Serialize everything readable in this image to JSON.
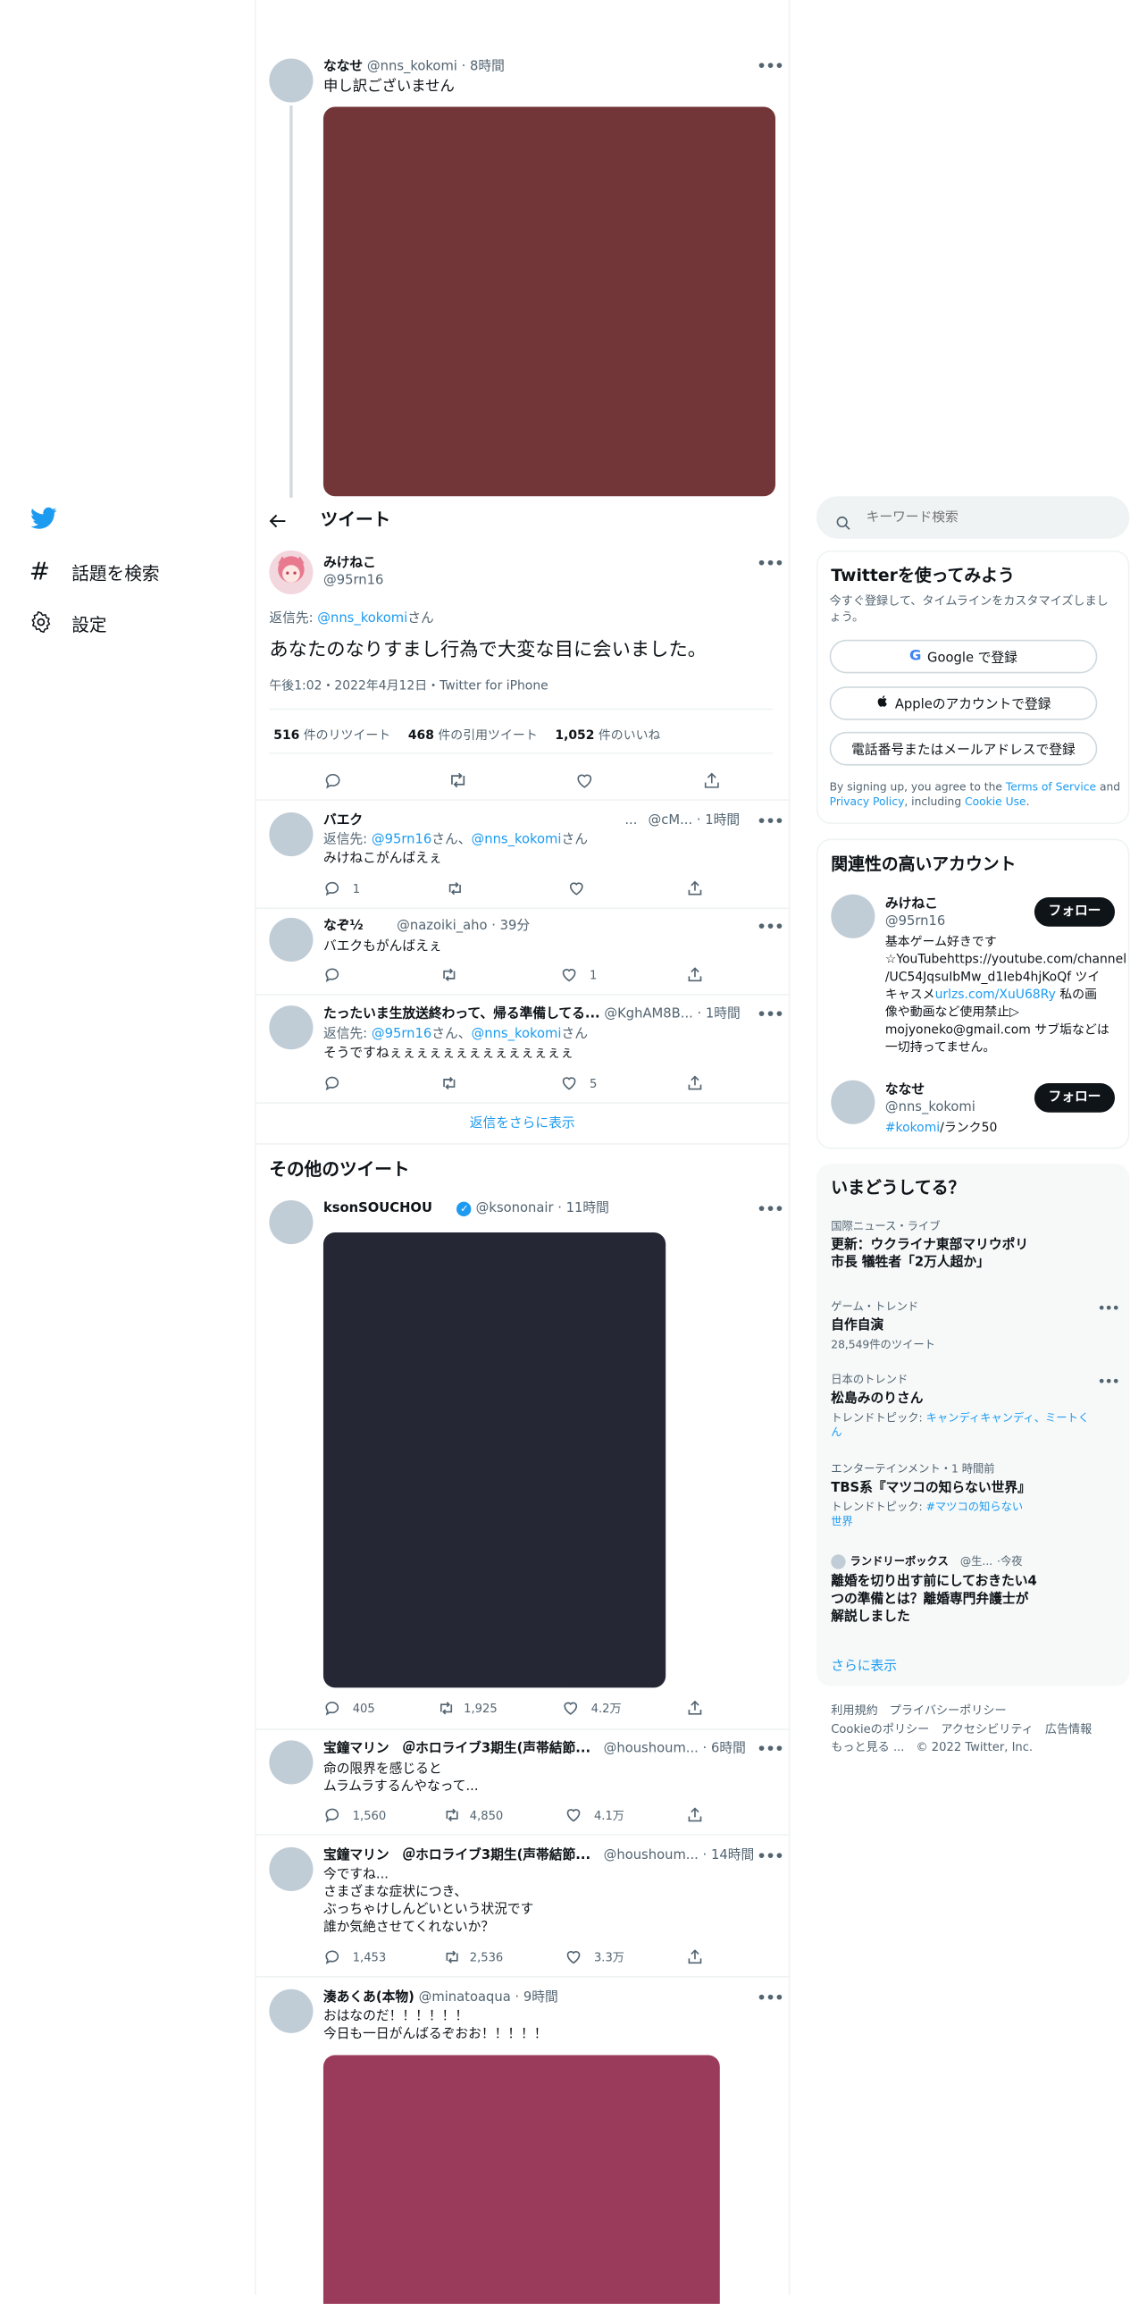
{
  "nav": {
    "explore_label": "話題を検索",
    "settings_label": "設定"
  },
  "header": {
    "title": "ツイート"
  },
  "top_tweet": {
    "name": "ななせ",
    "handle": "@nns_kokomi",
    "time": "8時間",
    "text": "申し訳ございません",
    "media_color": "#733638"
  },
  "main_tweet": {
    "name": "みけねこ",
    "handle": "@95rn16",
    "reply_prefix": "返信先: ",
    "reply_to": "@nns_kokomi",
    "reply_suffix": "さん",
    "text": "あなたのなりすまし行為で大変な目に会いました。",
    "meta": "午後1:02・2022年4月12日・Twitter for iPhone",
    "retweets_count": "516",
    "retweets_label": " 件のリツイート",
    "quotes_count": "468",
    "quotes_label": " 件の引用ツイート",
    "likes_count": "1,052",
    "likes_label": " 件のいいね"
  },
  "replies": [
    {
      "name": "バエク",
      "handle": "@cM...",
      "time": "1時間",
      "reply_prefix": "返信先: ",
      "reply_to_1": "@95rn16",
      "reply_mid": "さん、",
      "reply_to_2": "@nns_kokomi",
      "reply_suffix": "さん",
      "text": "みけねこがんばえぇ",
      "reply_count": "1",
      "retweet_count": "",
      "like_count": ""
    },
    {
      "name": "なぞ½",
      "handle": "@nazoiki_aho",
      "time": "39分",
      "text": "バエクもがんばえぇ",
      "reply_count": "",
      "retweet_count": "",
      "like_count": "1"
    },
    {
      "name": "たったいま生放送終わって、帰る準備してる...",
      "handle": "@KghAM8B...",
      "time": "1時間",
      "reply_prefix": "返信先: ",
      "reply_to_1": "@95rn16",
      "reply_mid": "さん、",
      "reply_to_2": "@nns_kokomi",
      "reply_suffix": "さん",
      "text": "そうですねぇぇぇぇぇぇぇぇぇぇぇぇぇぇ",
      "reply_count": "",
      "retweet_count": "",
      "like_count": "5"
    }
  ],
  "show_more_replies": "返信をさらに表示",
  "more_tweets_title": "その他のツイート",
  "more_tweets": [
    {
      "name": "ksonSOUCHOU",
      "handle": "@ksononair",
      "time": "11時間",
      "media_color": "#252734",
      "reply_count": "405",
      "retweet_count": "1,925",
      "like_count": "4.2万"
    },
    {
      "name": "宝鐘マリン　＠ホロライブ3期生(声帯結節...",
      "handle": "@houshoum...",
      "time": "6時間",
      "line1": "命の限界を感じると",
      "line2": "ムラムラするんやなって...",
      "reply_count": "1,560",
      "retweet_count": "4,850",
      "like_count": "4.1万"
    },
    {
      "name": "宝鐘マリン　＠ホロライブ3期生(声帯結節...",
      "handle": "@houshoum...",
      "time": "14時間",
      "line1": "今ですね...",
      "line2": "さまざまな症状につき、",
      "line3": "ぶっちゃけしんどいという状況です",
      "line4": "誰か気絶させてくれないか？",
      "reply_count": "1,453",
      "retweet_count": "2,536",
      "like_count": "3.3万"
    },
    {
      "name": "湊あくあ(本物)",
      "handle": "@minatoaqua",
      "time": "9時間",
      "line1": "おはなのだ！！！！！！",
      "line2": "今日も一日がんばるぞおお！！！！！",
      "media_color": "#9a3b5c"
    }
  ],
  "search": {
    "placeholder": "キーワード検索"
  },
  "signup": {
    "title": "Twitterを使ってみよう",
    "subtitle": "今すぐ登録して、タイムラインをカスタマイズしましょう。",
    "google_label": "Google で登録",
    "apple_label": "Appleのアカウントで登録",
    "phone_label": "電話番号またはメールアドレスで登録",
    "legal_1": "By signing up, you agree to the ",
    "tos": "Terms of Service",
    "legal_2": " and ",
    "privacy": "Privacy Policy",
    "legal_3": ", including ",
    "cookie": "Cookie Use",
    "legal_4": "."
  },
  "relevant": {
    "title": "関連性の高いアカウント",
    "accounts": [
      {
        "name": "みけねこ",
        "handle": "@95rn16",
        "follow_label": "フォロー",
        "bio_line1": "基本ゲーム好きです",
        "bio_line2": "☆YouTubehttps://youtube.com/channel",
        "bio_line3": "/UC54JqsuIbMw_d1Ieb4hjKoQf ツイ",
        "bio_line4a": "キャスメ",
        "bio_link": "urlzs.com/XuU68Ry",
        "bio_line4b": " 私の画",
        "bio_line5": "像や動画など使用禁止▷",
        "bio_line6": "mojyoneko@gmail.com サブ垢などは",
        "bio_line7": "一切持ってません。"
      },
      {
        "name": "ななせ",
        "handle": "@nns_kokomi",
        "follow_label": "フォロー",
        "bio_tag": "#kokomi",
        "bio_rest": "/ランク50"
      }
    ]
  },
  "trends": {
    "title": "いまどうしてる？",
    "items": [
      {
        "context": "国際ニュース・ライブ",
        "title_line1": "更新：ウクライナ東部マリウポリ",
        "title_line2": "市長 犠牲者「2万人超か」"
      },
      {
        "context": "ゲーム・トレンド",
        "title_line1": "自作自演",
        "sub": "28,549件のツイート"
      },
      {
        "context": "日本のトレンド",
        "title_line1": "松島みのりさん",
        "sub_prefix": "トレンドトピック: ",
        "sub_link1": "キャンディキャンディ、ミートく",
        "sub_link2": "ん"
      },
      {
        "context": "エンターテインメント・1 時間前",
        "title_line1": "TBS系『マツコの知らない世界』",
        "sub_prefix": "トレンドトピック: ",
        "sub_link1": "#マツコの知らない",
        "sub_link2": "世界"
      },
      {
        "context_name": "ランドリーボックス",
        "context_handle": "@生...",
        "context_time": "今夜",
        "title_line1": "離婚を切り出す前にしておきたい4",
        "title_line2": "つの準備とは？離婚専門弁護士が",
        "title_line3": "解説しました"
      }
    ],
    "show_more": "さらに表示"
  },
  "footer": {
    "terms": "利用規約",
    "privacy": "プライバシーポリシー",
    "cookie": "Cookieのポリシー",
    "accessibility": "アクセシビリティ",
    "ads": "広告情報",
    "more": "もっと見る ...",
    "copyright": "© 2022 Twitter, Inc."
  },
  "colors": {
    "accent": "#1d9bf0",
    "text": "#0f1419",
    "secondary": "#536471",
    "border": "#eff3f4"
  }
}
